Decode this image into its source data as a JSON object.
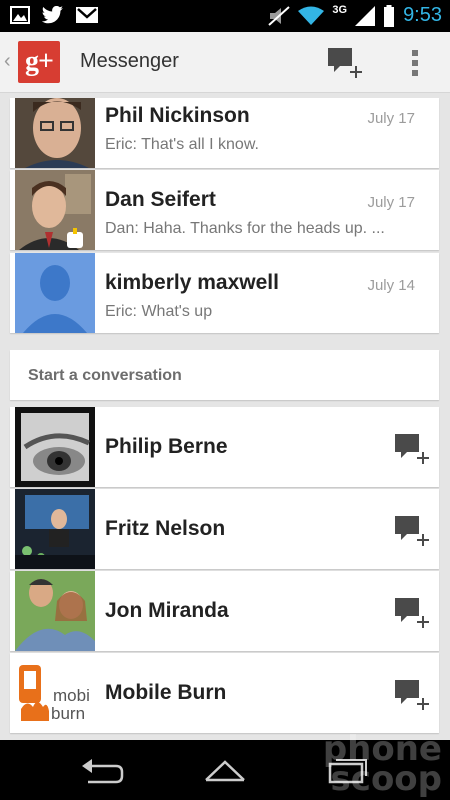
{
  "status_bar": {
    "time": "9:53",
    "network": "3G",
    "icons": [
      "gallery-icon",
      "twitter-icon",
      "gmail-icon",
      "mute-icon",
      "wifi-icon",
      "signal-icon",
      "battery-icon"
    ]
  },
  "action_bar": {
    "title": "Messenger",
    "logo_text": "g+",
    "brand_color": "#d73d32",
    "actions": [
      "new-message-icon",
      "overflow-menu-icon"
    ]
  },
  "conversations": [
    {
      "name": "Phil Nickinson",
      "date": "July 17",
      "snippet": "Eric: That's all I know."
    },
    {
      "name": "Dan Seifert",
      "date": "July 17",
      "snippet": "Dan: Haha. Thanks for the heads up. ..."
    },
    {
      "name": "kimberly maxwell",
      "date": "July 14",
      "snippet": "Eric: What's up"
    }
  ],
  "start_section": {
    "label": "Start a conversation"
  },
  "contacts": [
    {
      "name": "Philip Berne"
    },
    {
      "name": "Fritz Nelson"
    },
    {
      "name": "Jon Miranda"
    },
    {
      "name": "Mobile Burn",
      "logo_text_top": "mobi",
      "logo_text_bottom": "burn"
    }
  ],
  "watermark": {
    "line1": "phone",
    "line2": "scoop"
  }
}
